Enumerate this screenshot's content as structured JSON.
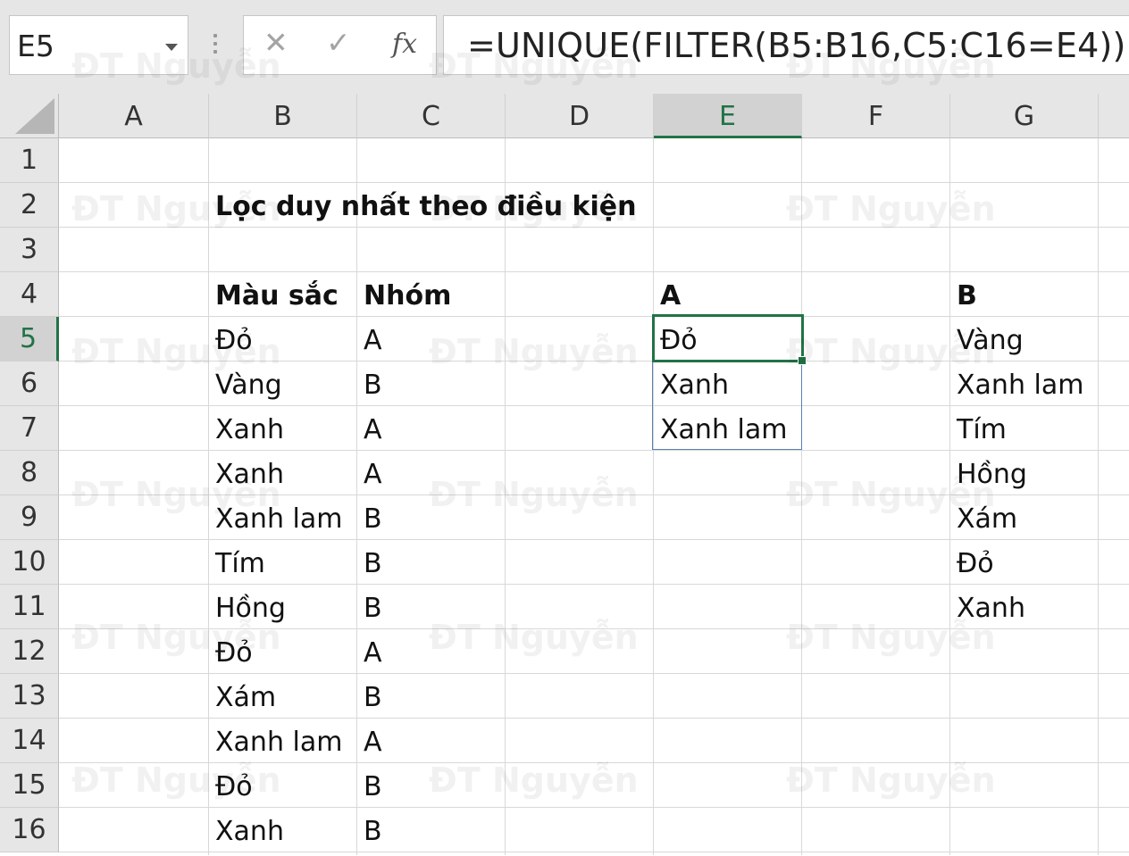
{
  "name_box": {
    "value": "E5"
  },
  "formula_bar": {
    "cancel_icon": "✕",
    "enter_icon": "✓",
    "fx_label": "fx",
    "formula": "=UNIQUE(FILTER(B5:B16,C5:C16=E4))"
  },
  "columns": [
    "A",
    "B",
    "C",
    "D",
    "E",
    "F",
    "G"
  ],
  "active_column": "E",
  "rows": [
    "1",
    "2",
    "3",
    "4",
    "5",
    "6",
    "7",
    "8",
    "9",
    "10",
    "11",
    "12",
    "13",
    "14",
    "15",
    "16"
  ],
  "active_row": "5",
  "title": "Lọc duy nhất theo điều kiện",
  "headers": {
    "color": "Màu sắc",
    "group": "Nhóm"
  },
  "table": [
    {
      "color": "Đỏ",
      "group": "A"
    },
    {
      "color": "Vàng",
      "group": "B"
    },
    {
      "color": "Xanh",
      "group": "A"
    },
    {
      "color": "Xanh",
      "group": "A"
    },
    {
      "color": "Xanh lam",
      "group": "B"
    },
    {
      "color": "Tím",
      "group": "B"
    },
    {
      "color": "Hồng",
      "group": "B"
    },
    {
      "color": "Đỏ",
      "group": "A"
    },
    {
      "color": "Xám",
      "group": "B"
    },
    {
      "color": "Xanh lam",
      "group": "A"
    },
    {
      "color": "Đỏ",
      "group": "B"
    },
    {
      "color": "Xanh",
      "group": "B"
    }
  ],
  "criteria_a": {
    "header": "A",
    "results": [
      "Đỏ",
      "Xanh",
      "Xanh lam"
    ]
  },
  "criteria_b": {
    "header": "B",
    "results": [
      "Vàng",
      "Xanh lam",
      "Tím",
      "Hồng",
      "Xám",
      "Đỏ",
      "Xanh"
    ]
  },
  "watermark": "ĐT Nguyễn",
  "colors": {
    "accent": "#217346",
    "spill_border": "#5b7fb9",
    "header_bg": "#e6e6e6",
    "grid": "#d8d8d8"
  }
}
